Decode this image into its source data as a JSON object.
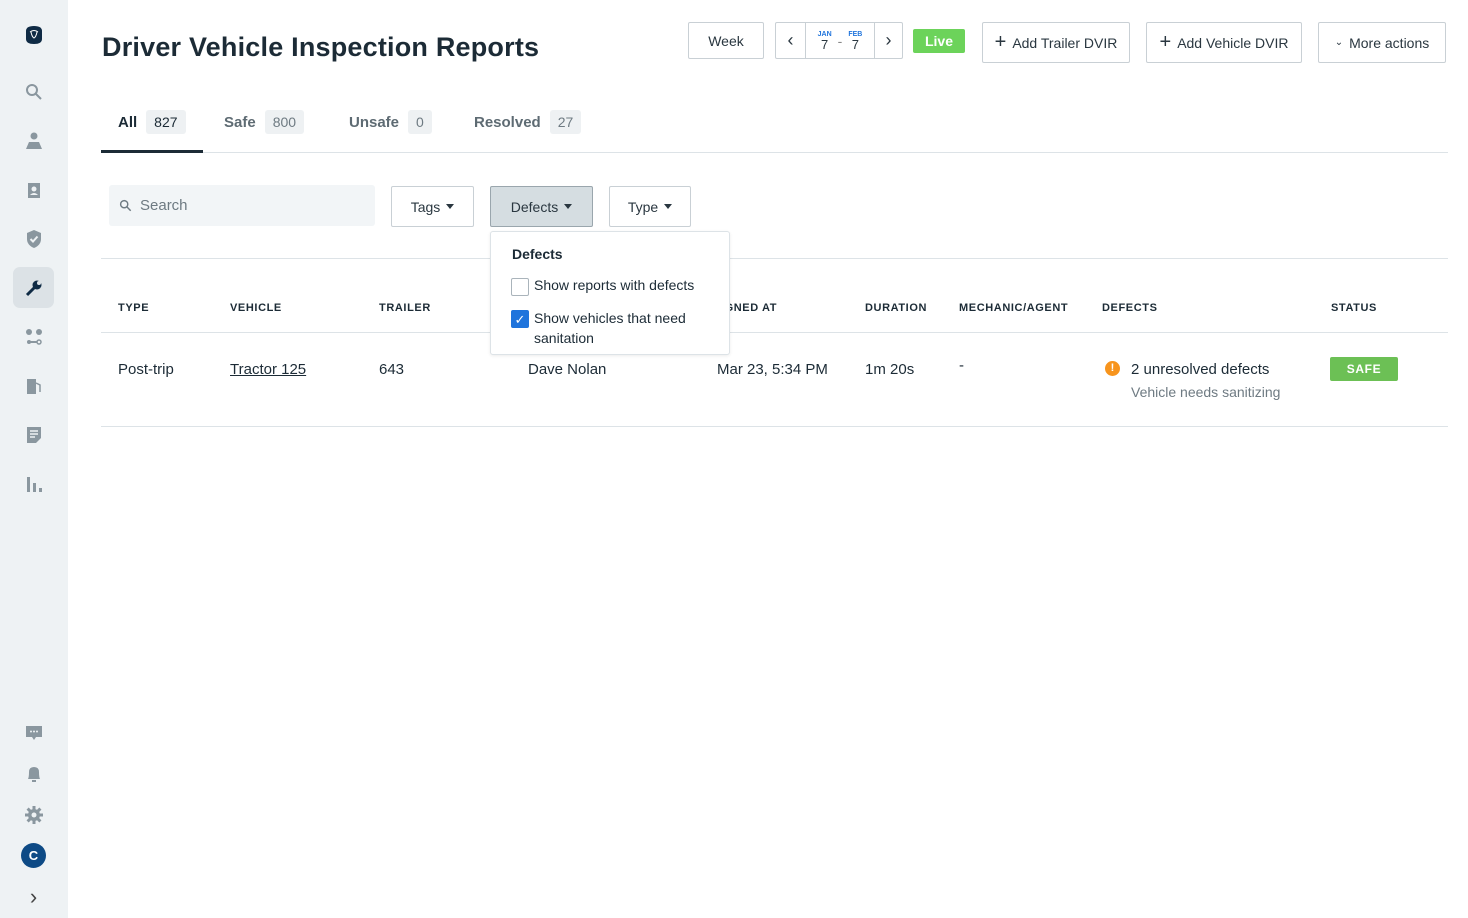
{
  "sidebar": {
    "items": [
      "logo-icon",
      "search-icon",
      "map-pin-icon",
      "driver-badge-icon",
      "shield-check-icon",
      "wrench-icon",
      "route-icon",
      "fuel-icon",
      "document-icon",
      "chart-icon"
    ],
    "active": "wrench-icon",
    "bottom": [
      "chat-icon",
      "bell-icon",
      "gear-icon"
    ],
    "avatar": "C",
    "expand": "›"
  },
  "header": {
    "title": "Driver Vehicle Inspection Reports",
    "range_mode": "Week",
    "date_from": {
      "month": "JAN",
      "day": "7"
    },
    "date_sep": "-",
    "date_to": {
      "month": "FEB",
      "day": "7"
    },
    "live": "Live",
    "add_trailer": "Add Trailer DVIR",
    "add_vehicle": "Add Vehicle DVIR",
    "more_actions": "More actions"
  },
  "tabs": [
    {
      "label": "All",
      "count": "827",
      "active": true
    },
    {
      "label": "Safe",
      "count": "800"
    },
    {
      "label": "Unsafe",
      "count": "0"
    },
    {
      "label": "Resolved",
      "count": "27"
    }
  ],
  "filters": {
    "search_placeholder": "Search",
    "tags": "Tags",
    "defects": "Defects",
    "type": "Type"
  },
  "defects_dropdown": {
    "title": "Defects",
    "options": [
      {
        "label": "Show reports with defects",
        "checked": false
      },
      {
        "label": "Show vehicles that need sanitation",
        "checked": true
      }
    ]
  },
  "table": {
    "columns": [
      "TYPE",
      "VEHICLE",
      "TRAILER",
      "SIGNED AT",
      "DURATION",
      "MECHANIC/AGENT",
      "DEFECTS",
      "STATUS"
    ],
    "rows": [
      {
        "type": "Post-trip",
        "vehicle": "Tractor 125",
        "trailer": "643",
        "driver": "Dave Nolan",
        "signed_at": "Mar 23, 5:34 PM",
        "duration": "1m 20s",
        "mechanic": "-",
        "defects": "2 unresolved defects",
        "defects_note": "Vehicle needs sanitizing",
        "status": "SAFE"
      }
    ]
  },
  "colors": {
    "accent": "#1f74dc",
    "live": "#6cd35a",
    "safe": "#6cc055",
    "warning": "#f7941d",
    "nav_dark": "#0f2b45"
  }
}
